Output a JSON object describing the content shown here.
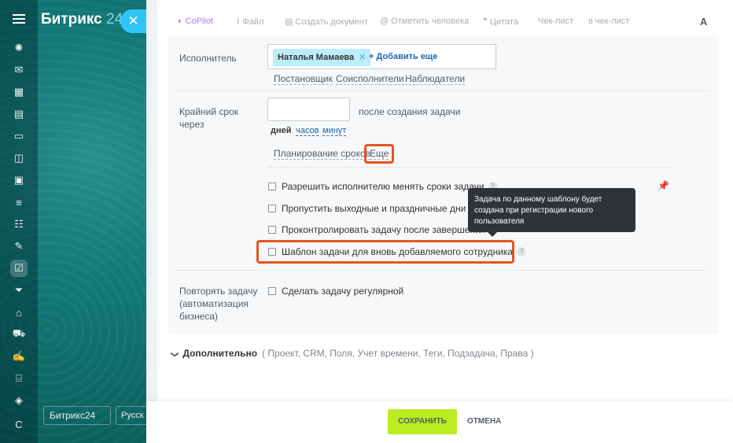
{
  "app": {
    "logo_name": "Битрикс",
    "logo_num": "24"
  },
  "close_glyph": "✕",
  "bottom": {
    "b24_badge": "Битрикс24",
    "lang_badge": "Русск"
  },
  "rail": {
    "bottom_letter": "С"
  },
  "toolbar": {
    "copilot": "CoPilot",
    "file": "Файл",
    "create_doc": "Создать документ",
    "mention": "Отметить человека",
    "quote": "Цитата",
    "checklist": "Чек-лист",
    "to_checklist": "в чек-лист",
    "format": "A"
  },
  "responsible": {
    "label": "Исполнитель",
    "person": "Наталья Мамаева",
    "add_more": "Добавить еще",
    "roles": [
      "Постановщик",
      "Соисполнители",
      "Наблюдатели"
    ]
  },
  "deadline": {
    "label": "Крайний срок через",
    "input_value": "",
    "after_text": "после создания задачи",
    "units": [
      "дней",
      "часов",
      "минут"
    ],
    "selected_unit": "дней",
    "planning_link": "Планирование сроков",
    "more_link": "Еще"
  },
  "options": [
    {
      "label": "Разрешить исполнителю менять сроки задачи",
      "checked": false,
      "help": "?"
    },
    {
      "label": "Пропустить выходные и праздничные дни",
      "checked": false,
      "help": "?"
    },
    {
      "label": "Проконтролировать задачу после завершения",
      "checked": false,
      "help": ""
    },
    {
      "label": "Шаблон задачи для вновь добавляемого сотрудника",
      "checked": false,
      "help": "?"
    }
  ],
  "tooltip": "Задача по данному шаблону будет создана при регистрации нового пользователя",
  "repeat": {
    "label": "Повторять задачу (автоматизация бизнеса)",
    "checkbox_label": "Сделать задачу регулярной"
  },
  "additional": {
    "title": "Дополнительно",
    "items": "( Проект,  CRM,  Поля,  Учет времени,  Теги,  Подзадача,  Права )"
  },
  "footer": {
    "save": "СОХРАНИТЬ",
    "cancel": "ОТМЕНА"
  },
  "colors": {
    "accent_green": "#bbed21",
    "highlight": "#e8531f",
    "link": "#2067b0",
    "chip": "#bcedfc"
  }
}
